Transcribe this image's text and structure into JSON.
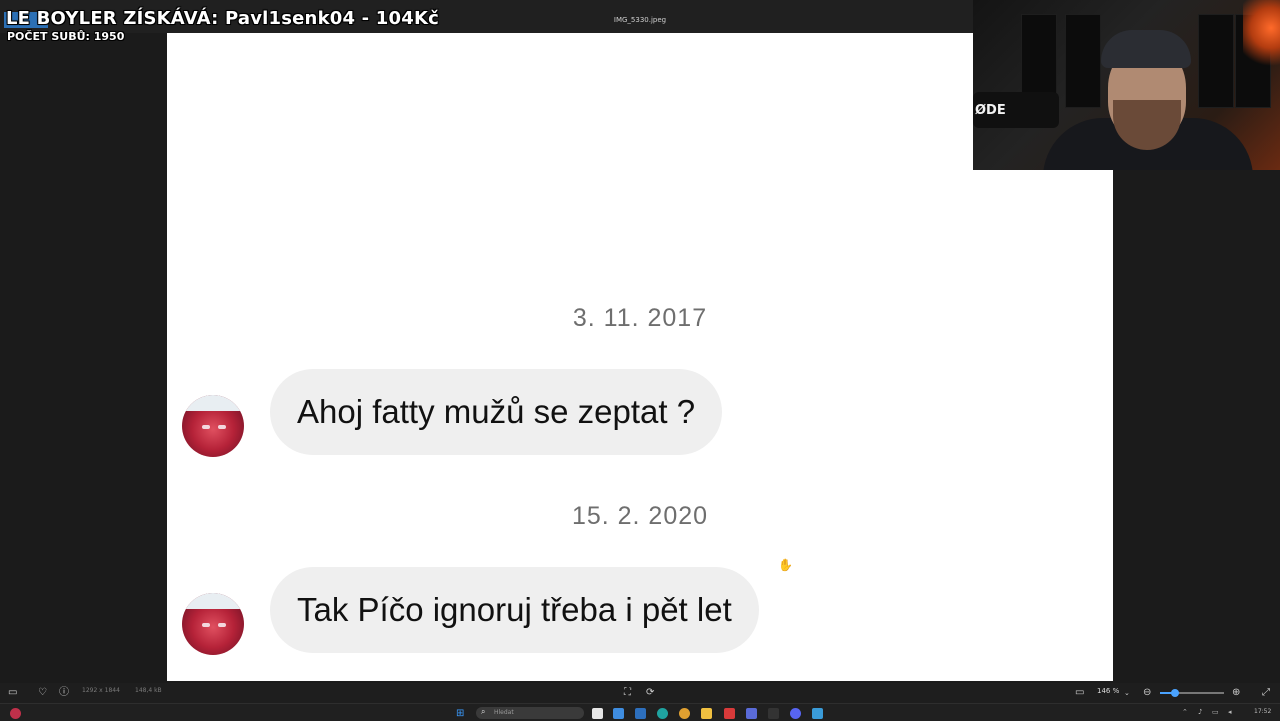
{
  "viewer": {
    "filename": "IMG_5330.jpeg",
    "image_dimensions": "1292 x 1844",
    "file_size": "148,4 kB",
    "zoom": "146 %"
  },
  "stream_overlay": {
    "title": "LE BOYLER ZÍSKÁVÁ: Pavl1senk04 - 104Kč",
    "subs": "POČET SUBŮ: 1950"
  },
  "chat": {
    "messages": [
      {
        "date": "3. 11. 2017",
        "text": "Ahoj fatty mužů se zeptat ?"
      },
      {
        "date": "15. 2. 2020",
        "text": "Tak Píčo ignoruj třeba i pět let"
      }
    ]
  },
  "webcam": {
    "mic_label": "ØDE"
  },
  "taskbar": {
    "search_placeholder": "Hledat",
    "time": "17:52"
  }
}
